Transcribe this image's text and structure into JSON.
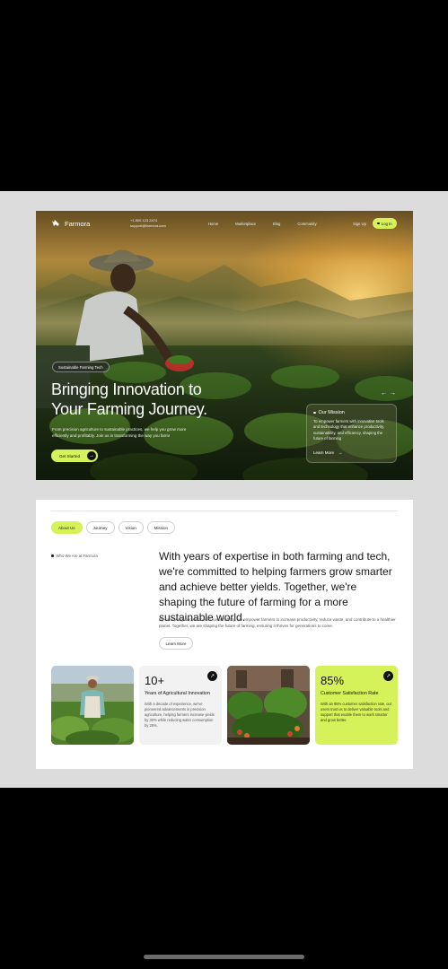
{
  "nav": {
    "brand": "Farmora",
    "phone": "+1 800 123 2474",
    "email": "support@farmora.com",
    "links": [
      "Home",
      "Marketplace",
      "Blog",
      "Community"
    ],
    "signup": "Sign Up",
    "login": "Log In"
  },
  "hero": {
    "tag": "Sustainable Farming Tech",
    "headline_line1": "Bringing Innovation to",
    "headline_line2": "Your Farming Journey.",
    "description": "From precision agriculture to sustainable practices, we help you grow more efficiently and profitably. Join us in transforming the way you farm!",
    "cta": "Get Started",
    "mission": {
      "title": "Our Mission",
      "text": "To empower farmers with innovative tools and technology that enhance productivity, sustainability, and efficiency, shaping the future of farming",
      "link": "Learn More"
    }
  },
  "about": {
    "tabs": [
      "About Us",
      "Journey",
      "Vision",
      "Mission"
    ],
    "who_label": "Who We Are at Farmora",
    "statement": "With years of expertise in both farming and tech, we're committed to helping farmers grow smarter and achieve better yields. Together, we're shaping the future of farming for a more sustainable world.",
    "body": "By combining innovation with sustainability, we empower farmers to increase productivity, reduce waste, and contribute to a healthier planet. Together, we are shaping the future of farming, ensuring it thrives for generations to come.",
    "learn_more": "Learn More",
    "stats": [
      {
        "number": "10+",
        "title": "Years of Agricultural Innovation",
        "description": "With a decade of experience, we've pioneered advancements in precision agriculture, helping farmers increase yields by 30% while reducing water consumption by 25%."
      },
      {
        "number": "85%",
        "title": "Customer Satisfaction Rate",
        "description": "With an 85% customer satisfaction rate, our users trust us to deliver valuable tools and support that enable them to work smarter and grow better."
      }
    ]
  },
  "colors": {
    "accent": "#d5f25a",
    "background": "#000000",
    "panel": "#dcdcdc"
  }
}
